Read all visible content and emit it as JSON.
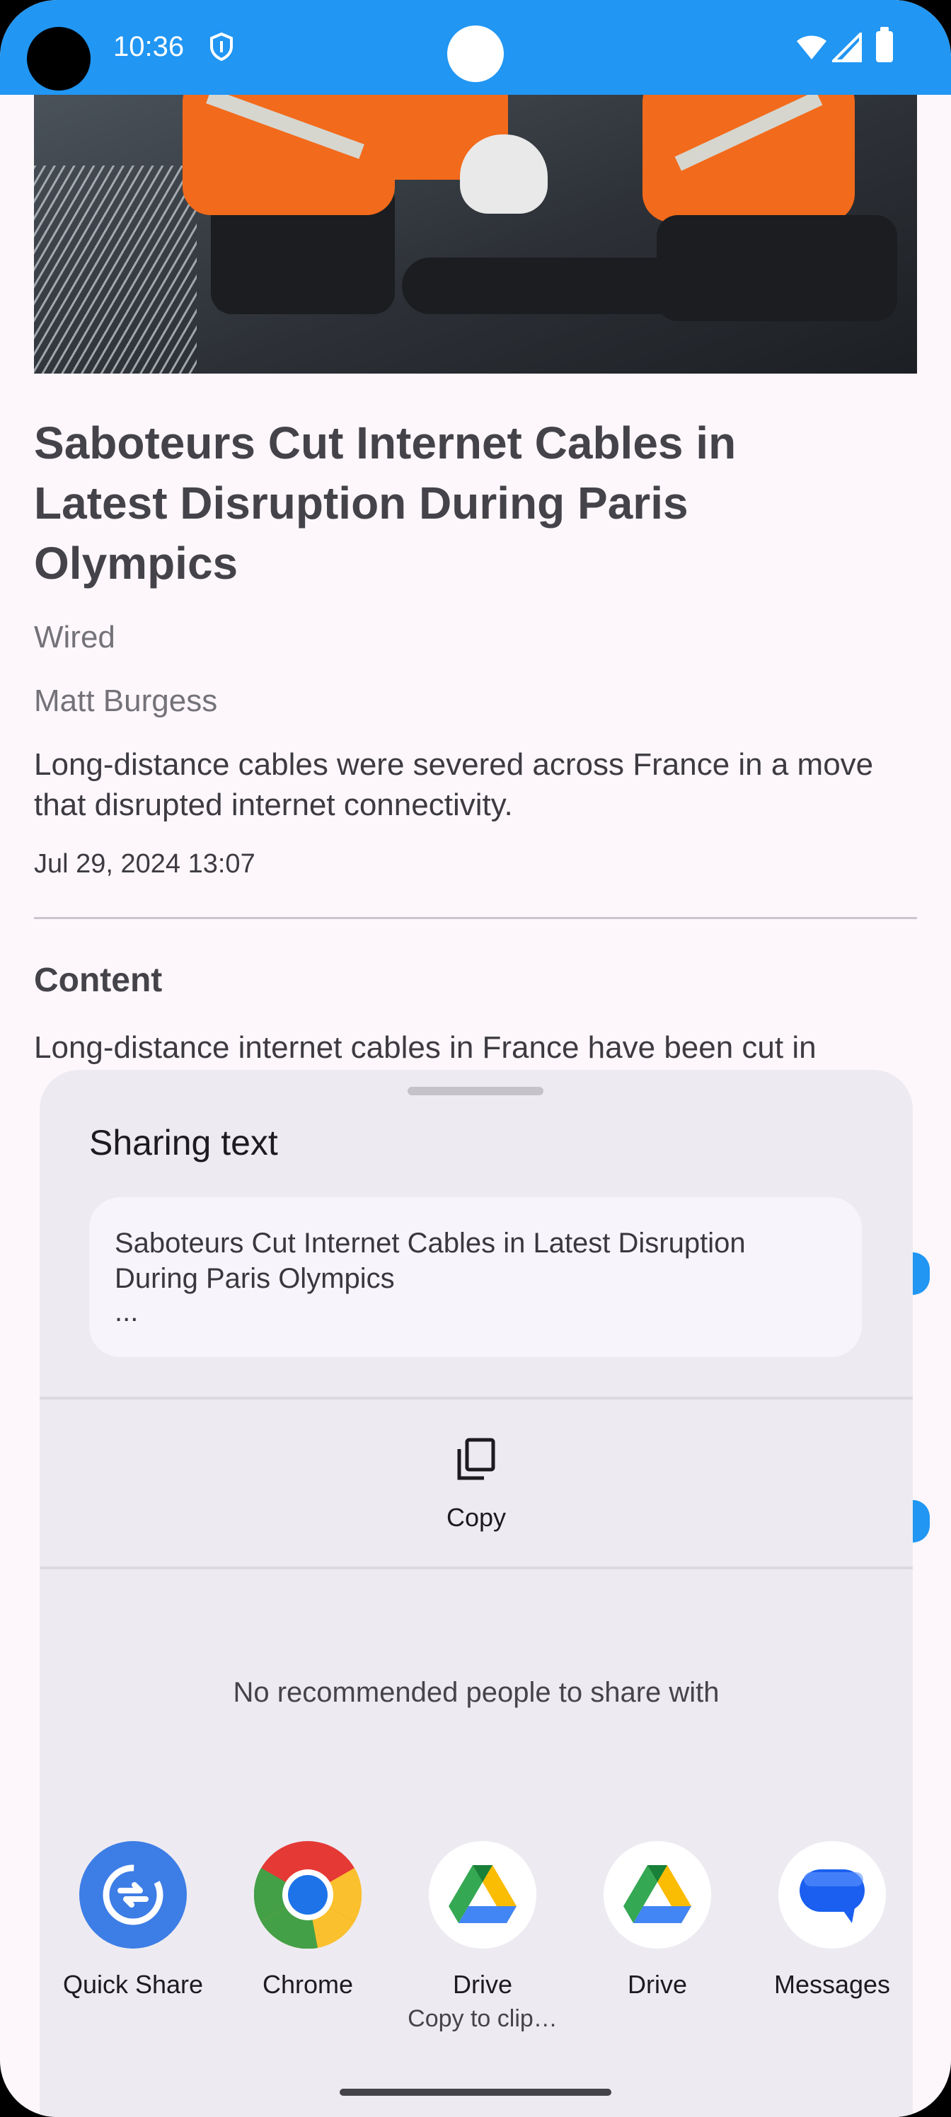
{
  "status_bar": {
    "time": "10:36"
  },
  "article": {
    "title": "Saboteurs Cut Internet Cables in Latest Disruption During Paris Olympics",
    "source": "Wired",
    "author": "Matt Burgess",
    "summary": "Long-distance cables were severed across France in a move that disrupted internet connectivity.",
    "date": "Jul 29, 2024 13:07",
    "content_heading": "Content",
    "content_text": "Long-distance internet cables in France have been cut in"
  },
  "share_sheet": {
    "title": "Sharing text",
    "preview_text": "Saboteurs Cut Internet Cables in Latest Disruption During Paris Olympics",
    "preview_more": "...",
    "copy_label": "Copy",
    "no_people": "No recommended people to share with",
    "apps": [
      {
        "label": "Quick Share",
        "sub": "",
        "icon": "quick-share-icon"
      },
      {
        "label": "Chrome",
        "sub": "",
        "icon": "chrome-icon"
      },
      {
        "label": "Drive",
        "sub": "Copy to clip…",
        "icon": "drive-icon"
      },
      {
        "label": "Drive",
        "sub": "",
        "icon": "drive-icon"
      },
      {
        "label": "Messages",
        "sub": "",
        "icon": "messages-icon"
      }
    ]
  },
  "colors": {
    "status_bar": "#2196f3",
    "sheet": "#edebf1"
  }
}
